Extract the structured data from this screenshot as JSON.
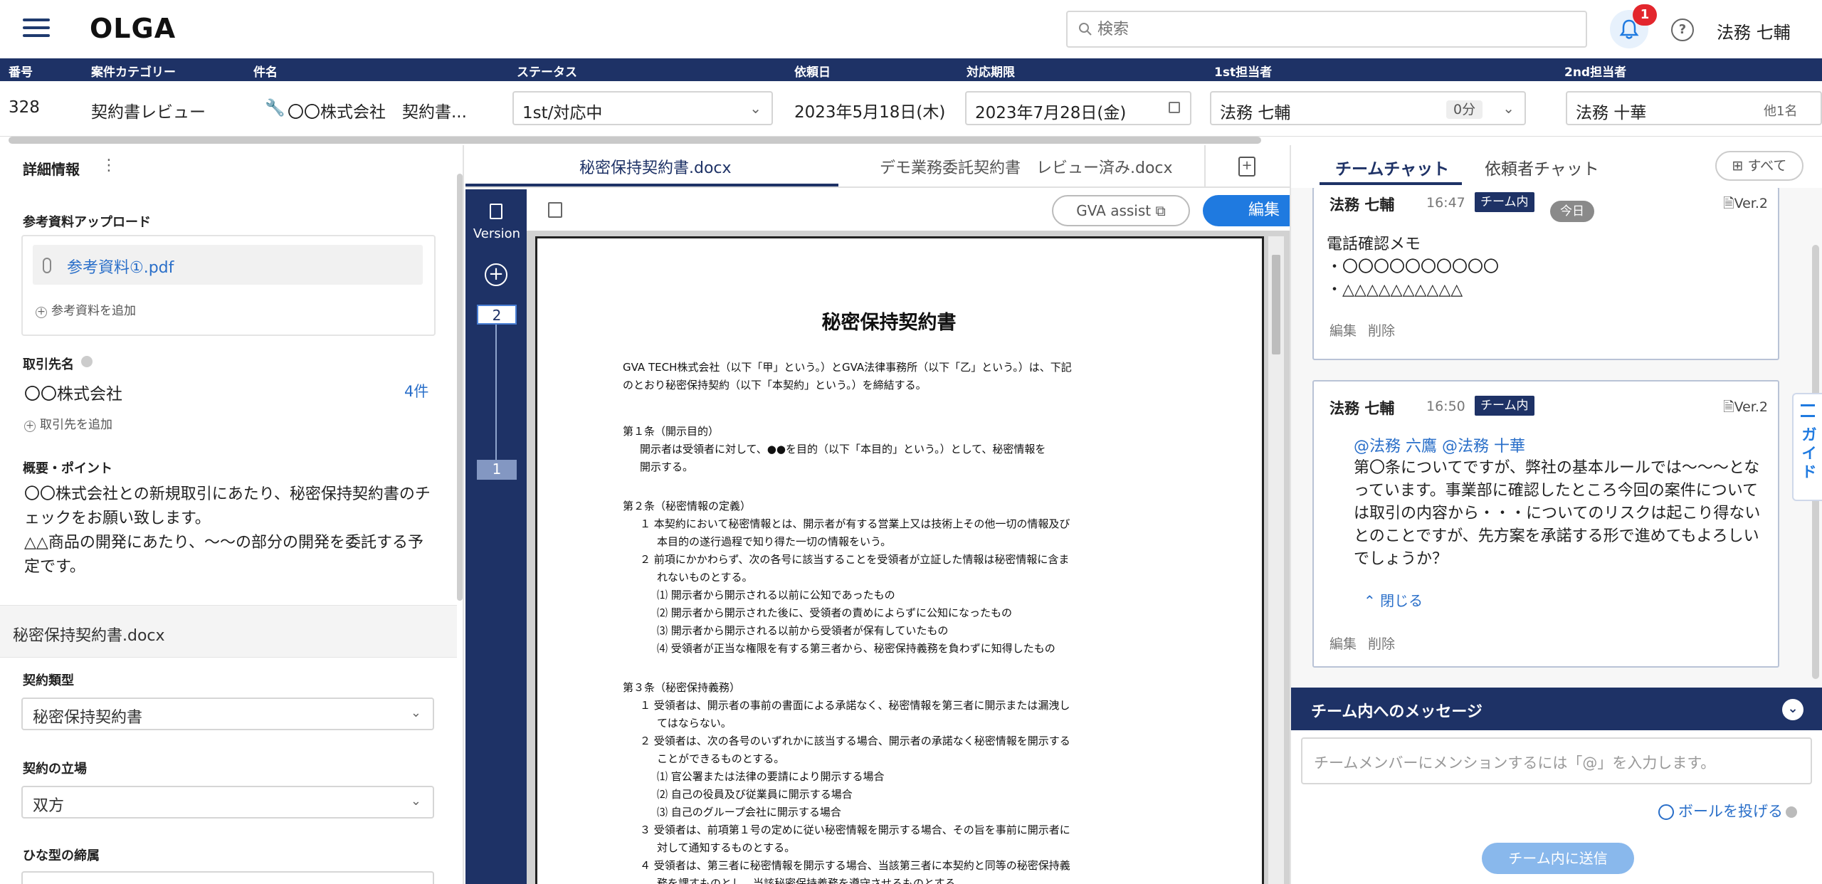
{
  "app": {
    "title": "OLGA"
  },
  "search": {
    "placeholder": "検索"
  },
  "notifications": {
    "count": "1"
  },
  "user": {
    "name": "法務 七輔"
  },
  "case_table": {
    "headers": [
      "番号",
      "案件カテゴリー",
      "件名",
      "ステータス",
      "依頼日",
      "対応期限",
      "1st担当者",
      "2nd担当者"
    ],
    "row": {
      "number": "328",
      "category": "契約書レビュー",
      "subject": "〇〇株式会社　契約書...",
      "status": "1st/対応中",
      "request_date": "2023年5月18日(木)",
      "deadline": "2023年7月28日(金)",
      "first_assignee": "法務 七輔",
      "first_time": "0分",
      "second_assignee": "法務 十華",
      "second_extra": "他1名"
    }
  },
  "details": {
    "title": "詳細情報",
    "upload_title": "参考資料アップロード",
    "file_name": "参考資料①.pdf",
    "add_file": "参考資料を追加",
    "partner_title": "取引先名",
    "partner": "〇〇株式会社",
    "partner_count": "4件",
    "add_partner": "取引先を追加",
    "summary_title": "概要・ポイント",
    "summary": "〇〇株式会社との新規取引にあたり、秘密保持契約書のチェックをお願い致します。\n△△商品の開発にあたり、〜〜の部分の開発を委託する予定です。",
    "doc_name": "秘密保持契約書.docx",
    "contract_type_label": "契約類型",
    "contract_type": "秘密保持契約書",
    "position_label": "契約の立場",
    "position": "双方",
    "template_label": "ひな型の締属"
  },
  "viewer": {
    "tabs": [
      "秘密保持契約書.docx",
      "デモ業務委託契約書　レビュー済み.docx"
    ],
    "version_label": "Version",
    "versions": [
      "2",
      "1"
    ],
    "assist_label": "GVA assist",
    "edit_label": "編集",
    "document": {
      "title": "秘密保持契約書",
      "lines": [
        "GVA TECH株式会社（以下「甲」という。）とGVA法律事務所（以下「乙」という。）は、下記",
        "のとおり秘密保持契約（以下「本契約」という。）を締結する。",
        "第１条（開示目的）",
        "開示者は受領者に対して、●●を目的（以下「本目的」という。）として、秘密情報を",
        "開示する。",
        "第２条（秘密情報の定義）",
        "１ 本契約において秘密情報とは、開示者が有する営業上又は技術上その他一切の情報及び",
        "本目的の遂行過程で知り得た一切の情報をいう。",
        "２ 前項にかかわらず、次の各号に該当することを受領者が立証した情報は秘密情報に含ま",
        "れないものとする。",
        "⑴ 開示者から開示される以前に公知であったもの",
        "⑵ 開示者から開示された後に、受領者の責めによらずに公知になったもの",
        "⑶ 開示者から開示される以前から受領者が保有していたもの",
        "⑷ 受領者が正当な権限を有する第三者から、秘密保持義務を負わずに知得したもの",
        "第３条（秘密保持義務）",
        "１ 受領者は、開示者の事前の書面による承諾なく、秘密情報を第三者に開示または漏洩し",
        "てはならない。",
        "２ 受領者は、次の各号のいずれかに該当する場合、開示者の承諾なく秘密情報を開示する",
        "ことができるものとする。",
        "⑴ 官公署または法律の要請により開示する場合",
        "⑵ 自己の役員及び従業員に開示する場合",
        "⑶ 自己のグループ会社に開示する場合",
        "３ 受領者は、前項第１号の定めに従い秘密情報を開示する場合、その旨を事前に開示者に",
        "対して通知するものとする。",
        "４ 受領者は、第三者に秘密情報を開示する場合、当該第三者に本契約と同等の秘密保持義",
        "務を課すものとし、当該秘密保持義務を遵守させるものとする。"
      ]
    }
  },
  "chat": {
    "tabs": [
      "チームチャット",
      "依頼者チャット"
    ],
    "all_label": "すべて",
    "messages": [
      {
        "author": "法務 七輔",
        "time": "16:47",
        "badge": "チーム内",
        "day": "今日",
        "version": "Ver.2",
        "lines": [
          "電話確認メモ",
          "・〇〇〇〇〇〇〇〇〇〇",
          "・△△△△△△△△△△"
        ],
        "edit": "編集",
        "delete": "削除"
      },
      {
        "author": "法務 七輔",
        "time": "16:50",
        "badge": "チーム内",
        "version": "Ver.2",
        "mention": "@法務 六鷹 @法務 十華",
        "text": "第〇条についてですが、弊社の基本ルールでは〜〜〜となっています。事業部に確認したところ今回の案件については取引の内容から・・・についてのリスクは起こり得ないとのことですが、先方案を承諾する形で進めてもよろしいでしょうか？",
        "collapse": "閉じる",
        "edit": "編集",
        "delete": "削除"
      }
    ],
    "guide_label": "ガイド",
    "compose_title": "チーム内へのメッセージ",
    "compose_placeholder": "チームメンバーにメンションするには「@」を入力します。",
    "ball_label": "ボールを投げる",
    "send_label": "チーム内に送信"
  },
  "colors": {
    "navy": "#1e3266",
    "accent": "#1f7ae0",
    "notification": "#e3262d"
  }
}
